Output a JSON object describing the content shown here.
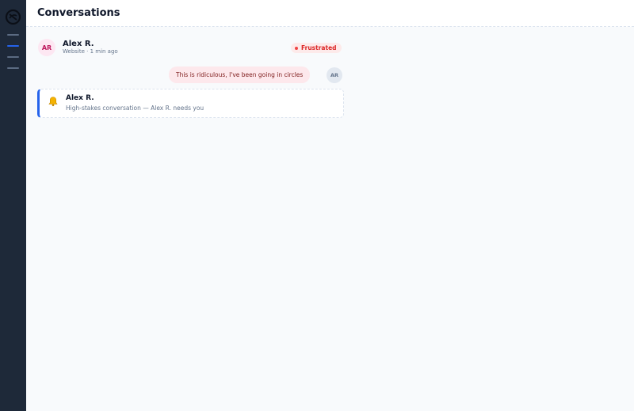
{
  "header": {
    "title": "Conversations"
  },
  "conversation": {
    "avatar_initials": "AR",
    "contact_name": "Alex R.",
    "meta": "Website · 1 min ago",
    "status": "Frustrated",
    "message": {
      "text": "This is ridiculous, I've been going in circles",
      "avatar_initials": "AR"
    }
  },
  "alert": {
    "icon": "bell-icon",
    "title": "Alex R.",
    "body": "High-stakes conversation — Alex R. needs you"
  },
  "colors": {
    "sidebar": "#1e2939",
    "accent": "#2563eb",
    "status_red": "#dc2626",
    "bubble_pink": "#fde8ec"
  }
}
